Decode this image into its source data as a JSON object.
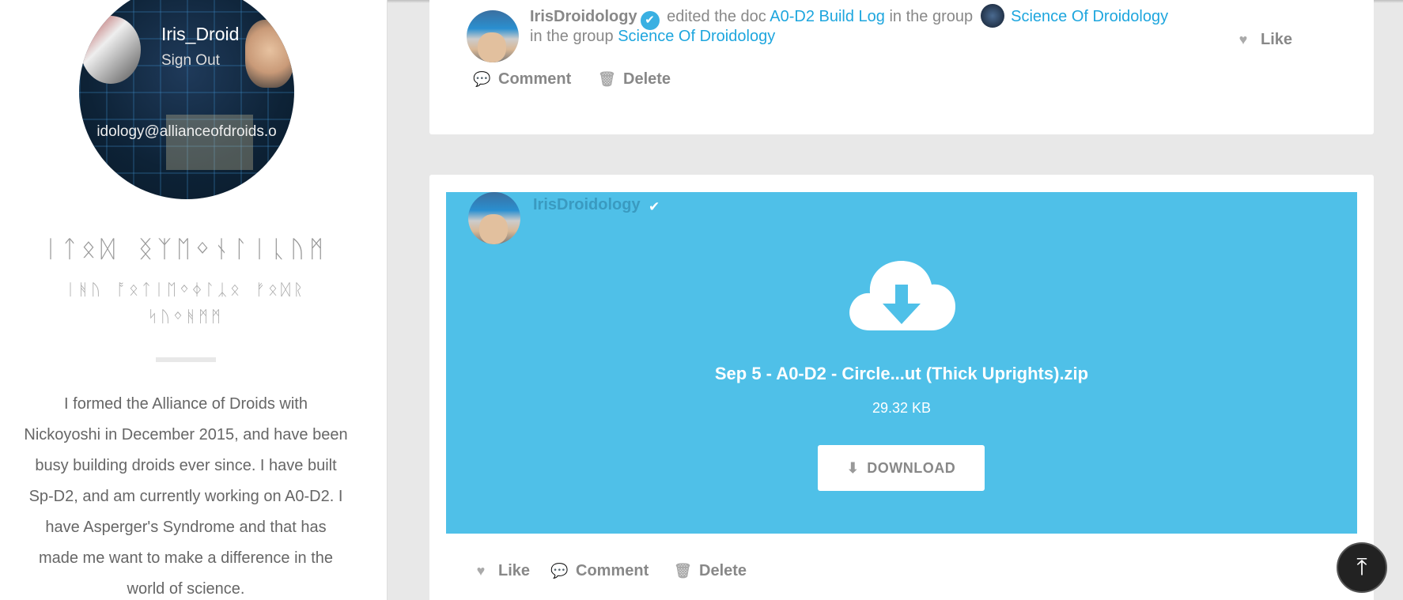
{
  "profile": {
    "username": "Iris_Droid",
    "sign_out": "Sign Out",
    "email": "idology@allianceofdroids.o",
    "aurebesh_title": "ᛁᛏᛟᛞ ᛝᛉᛖᛜᚾᛚᛁᚳᚢᛗ",
    "aurebesh_sub_line1": "ᛁᚻᚢ ᚩᛟᛏᛁᛖᛜᛄᛚᛣᛟ ᚠᛟᛞᚱ",
    "aurebesh_sub_line2": "ᛋᚢᛜᚻᛗᛗ",
    "bio": "I formed the Alliance of Droids with Nickoyoshi in December 2015, and have been busy building droids ever since. I have built Sp-D2, and am currently working on A0-D2. I have Asperger's Syndrome and that has made me want to make a difference in the world of science."
  },
  "post1": {
    "user": "IrisDroidology",
    "verb": "edited the doc",
    "doc_link": "A0-D2 Build Log",
    "in_the_group": "in the group",
    "group_link": "Science Of Droidology",
    "group_link_2": "Science Of Droidology",
    "like": "Like",
    "comment": "Comment",
    "delete": "Delete"
  },
  "post2": {
    "user": "IrisDroidology",
    "file_name": "Sep 5 - A0-D2 - Circle...ut (Thick Uprights).zip",
    "file_size": "29.32 KB",
    "download": "DOWNLOAD",
    "like": "Like",
    "comment": "Comment",
    "delete": "Delete"
  },
  "icons": {
    "verified": "check-circle-icon",
    "like": "heart-icon",
    "comment": "speech-bubble-icon",
    "delete": "trash-icon",
    "download_cloud": "cloud-download-icon",
    "download_btn": "download-icon",
    "scroll_top": "arrow-up-icon"
  },
  "colors": {
    "accent": "#1ea6de",
    "file_panel": "#4fc0e8",
    "scroll_top_bg": "#222222"
  }
}
